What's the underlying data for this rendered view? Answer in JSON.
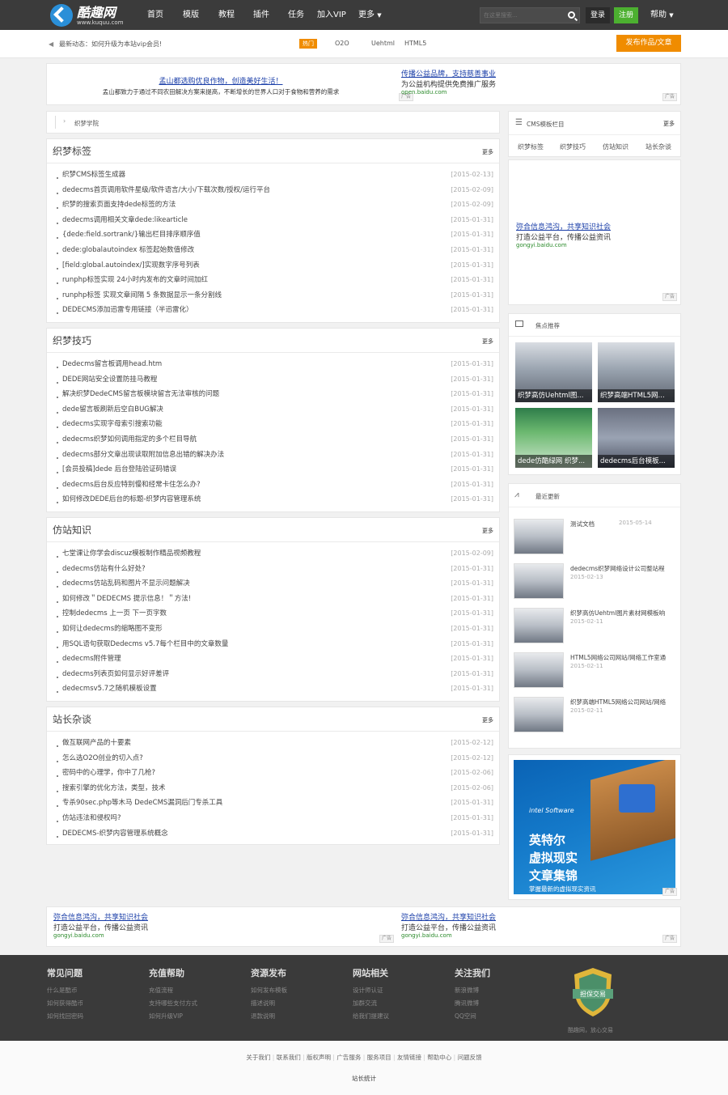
{
  "header": {
    "logo_title": "酷趣网",
    "logo_url": "www.kuquu.com",
    "nav": [
      "首页",
      "模版",
      "教程",
      "插件",
      "任务",
      "加入VIP",
      "更多"
    ],
    "search_placeholder": "在这里搜索...",
    "login": "登录",
    "register": "注册",
    "help": "帮助"
  },
  "notice": {
    "text": "最新动态：如何升级为本站vip会员!",
    "hot_badge": "热门",
    "hot_tags": [
      "O2O",
      "Uehtml",
      "HTML5"
    ],
    "publish_button": "发布作品/文章"
  },
  "ads": {
    "top_left": {
      "title": "孟山都选购优良作物，创造美好生活！",
      "desc": "孟山都致力于通过不同农田解决方案来提高，不断增长的世界人口对于食物和营养的需求"
    },
    "top_right": {
      "title": "传播公益品牌，支持慈善事业",
      "desc": "为公益机构提供免费推广服务",
      "url": "open.baidu.com"
    },
    "side": {
      "title": "弥合信息鸿沟，共享知识社会",
      "desc": "打造公益平台，传播公益资讯",
      "url": "gongyi.baidu.com"
    },
    "bottom_left": {
      "title": "弥合信息鸿沟，共享知识社会",
      "desc": "打造公益平台，传播公益资讯",
      "url": "gongyi.baidu.com"
    },
    "bottom_right": {
      "title": "弥合信息鸿沟，共享知识社会",
      "desc": "打造公益平台，传播公益资讯",
      "url": "gongyi.baidu.com"
    },
    "tag": "广告",
    "banner": {
      "brand": "intel Software",
      "line1": "英特尔",
      "line2": "虚拟现实",
      "line3": "文章集锦",
      "sub": "掌握最新的虚拟现实资讯"
    }
  },
  "breadcrumb": "织梦学院",
  "more_label": "更多",
  "sections": [
    {
      "title": "织梦标签",
      "items": [
        {
          "t": "织梦CMS标签生成器",
          "d": "[2015-02-13]"
        },
        {
          "t": "dedecms首页调用软件星级/软件语言/大小/下载次数/授权/运行平台",
          "d": "[2015-02-09]"
        },
        {
          "t": "织梦的搜索页面支持dede标签的方法",
          "d": "[2015-02-09]"
        },
        {
          "t": "dedecms调用相关文章dede:likearticle",
          "d": "[2015-01-31]"
        },
        {
          "t": "{dede:field.sortrank/}输出栏目排序顺序值",
          "d": "[2015-01-31]"
        },
        {
          "t": "dede:globalautoindex 标签起始数值修改",
          "d": "[2015-01-31]"
        },
        {
          "t": "[field:global.autoindex/]实现数字序号列表",
          "d": "[2015-01-31]"
        },
        {
          "t": "runphp标签实现 24小时内发布的文章时间加红",
          "d": "[2015-01-31]"
        },
        {
          "t": "runphp标签 实现文章间隔 5 条数据显示一条分割线",
          "d": "[2015-01-31]"
        },
        {
          "t": "DEDECMS添加迅雷专用链接（半迅雷化）",
          "d": "[2015-01-31]"
        }
      ]
    },
    {
      "title": "织梦技巧",
      "items": [
        {
          "t": "Dedecms留言板调用head.htm",
          "d": "[2015-01-31]"
        },
        {
          "t": "DEDE网站安全设置防挂马教程",
          "d": "[2015-01-31]"
        },
        {
          "t": "解决织梦DedeCMS留言板模块留言无法审核的问题",
          "d": "[2015-01-31]"
        },
        {
          "t": "dede留言板刷新后空白BUG解决",
          "d": "[2015-01-31]"
        },
        {
          "t": "dedecms实现字母索引搜索功能",
          "d": "[2015-01-31]"
        },
        {
          "t": "dedecms织梦如何调用指定的多个栏目导航",
          "d": "[2015-01-31]"
        },
        {
          "t": "dedecms部分文章出现读取附加信息出错的解决办法",
          "d": "[2015-01-31]"
        },
        {
          "t": "[会员投稿]dede 后台登陆验证码错误",
          "d": "[2015-01-31]"
        },
        {
          "t": "dedecms后台反应特别慢和经常卡住怎么办?",
          "d": "[2015-01-31]"
        },
        {
          "t": "如何修改DEDE后台的标题-织梦内容管理系统",
          "d": "[2015-01-31]"
        }
      ]
    },
    {
      "title": "仿站知识",
      "items": [
        {
          "t": "七堂课让你学会discuz模板制作精品视频教程",
          "d": "[2015-02-09]"
        },
        {
          "t": "dedecms仿站有什么好处?",
          "d": "[2015-01-31]"
        },
        {
          "t": "dedecms仿站乱码和图片不显示问题解决",
          "d": "[2015-01-31]"
        },
        {
          "t": "如何修改＂DEDECMS 提示信息！＂方法!",
          "d": "[2015-01-31]"
        },
        {
          "t": "控制dedecms 上一页 下一页字数",
          "d": "[2015-01-31]"
        },
        {
          "t": "如何让dedecms的缩略图不变形",
          "d": "[2015-01-31]"
        },
        {
          "t": "用SQL语句获取Dedecms v5.7每个栏目中的文章数量",
          "d": "[2015-01-31]"
        },
        {
          "t": "dedecms附件管理",
          "d": "[2015-01-31]"
        },
        {
          "t": "dedecms列表页如何显示好评差评",
          "d": "[2015-01-31]"
        },
        {
          "t": "dedecmsv5.7之随机模板设置",
          "d": "[2015-01-31]"
        }
      ]
    },
    {
      "title": "站长杂谈",
      "items": [
        {
          "t": "做互联网产品的十要素",
          "d": "[2015-02-12]"
        },
        {
          "t": "怎么选O2O创业的切入点?",
          "d": "[2015-02-12]"
        },
        {
          "t": "密码中的心理学，你中了几枪?",
          "d": "[2015-02-06]"
        },
        {
          "t": "搜索引擎的优化方法，类型，技术",
          "d": "[2015-02-06]"
        },
        {
          "t": "专杀90sec.php等木马 DedeCMS漏洞后门专杀工具",
          "d": "[2015-01-31]"
        },
        {
          "t": "仿站违法和侵权吗?",
          "d": "[2015-01-31]"
        },
        {
          "t": "DEDECMS-织梦内容管理系统概念",
          "d": "[2015-01-31]"
        }
      ]
    }
  ],
  "sidebar": {
    "cms_title": "CMS模板栏目",
    "cms_tabs": [
      "织梦标签",
      "织梦技巧",
      "仿站知识",
      "站长杂谈"
    ],
    "focus_title": "焦点推荐",
    "focus_items": [
      "织梦高仿Uehtml图...",
      "织梦高端HTML5网...",
      "dede仿酷绿网 织梦...",
      "dedecms后台模板..."
    ],
    "recent_title": "最近更新",
    "recent_items": [
      {
        "t": "测试文档",
        "d": "2015-05-14"
      },
      {
        "t": "dedecms织梦网络设计公司整站程",
        "d": "2015-02-13"
      },
      {
        "t": "织梦高仿Uehtml图片素材网模板响",
        "d": "2015-02-11"
      },
      {
        "t": "HTML5网络公司网站/网络工作室通",
        "d": "2015-02-11"
      },
      {
        "t": "织梦高端HTML5网络公司网站/网络",
        "d": "2015-02-11"
      }
    ]
  },
  "footer": {
    "cols": [
      {
        "h": "常见问题",
        "links": [
          "什么是酷币",
          "如何获得酷币",
          "如何找回密码"
        ]
      },
      {
        "h": "充值帮助",
        "links": [
          "充值流程",
          "支持哪些支付方式",
          "如何升级VIP"
        ]
      },
      {
        "h": "资源发布",
        "links": [
          "如何发布模板",
          "描述说明",
          "退款说明"
        ]
      },
      {
        "h": "网站相关",
        "links": [
          "设计师认证",
          "加群交流",
          "给我们提建议"
        ]
      },
      {
        "h": "关注我们",
        "links": [
          "新浪微博",
          "腾讯微博",
          "QQ空间"
        ]
      }
    ],
    "badge_text": "担保交易",
    "badge_sub": "酷趣网，放心交易",
    "bottom_links": [
      "关于我们",
      "联系我们",
      "版权声明",
      "广告服务",
      "服务项目",
      "友情链接",
      "帮助中心",
      "问题反馈"
    ],
    "stats": "站长统计"
  },
  "colors": {
    "topbar": "#3b3b3b",
    "accent_orange": "#f08c00",
    "register_green": "#4cb030",
    "footer": "#3a3a3a"
  }
}
